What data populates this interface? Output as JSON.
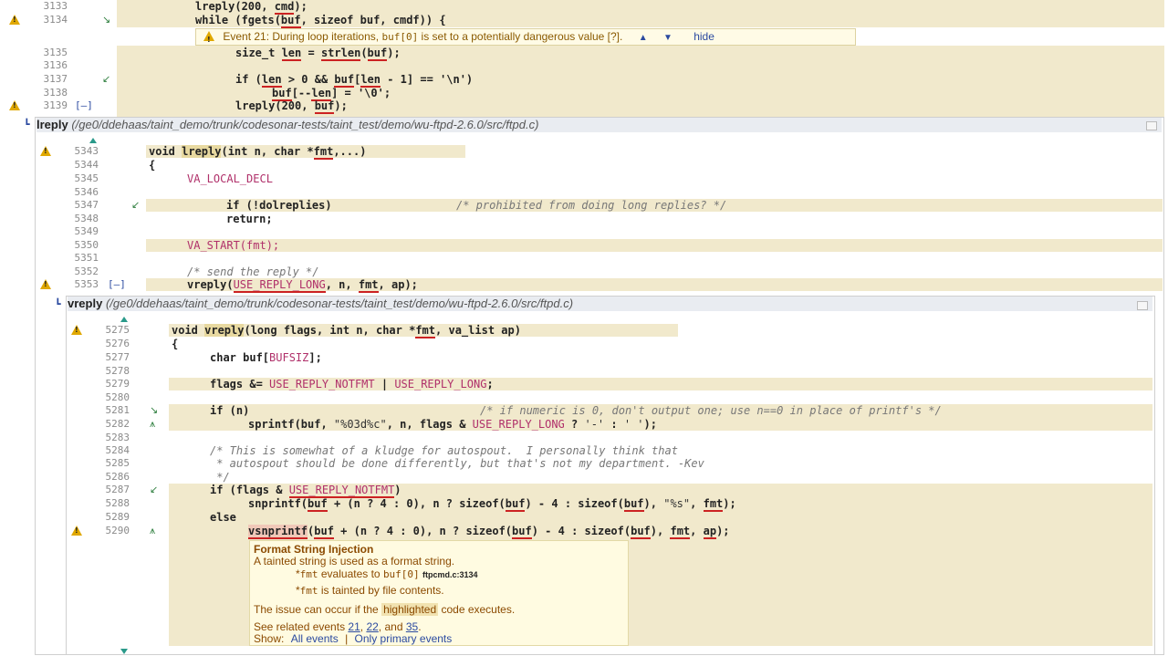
{
  "top_block": {
    "lines": [
      {
        "num": "3133",
        "code": "lreply(200, cmd);"
      },
      {
        "num": "3134",
        "code": "while (fgets(buf, sizeof buf, cmdf)) {"
      },
      {
        "num": "3135",
        "code": "size_t len = strlen(buf);"
      },
      {
        "num": "3136",
        "code": ""
      },
      {
        "num": "3137",
        "code": "if (len > 0 && buf[len - 1] == '\\n')"
      },
      {
        "num": "3138",
        "code": "buf[--len] = '\\0';"
      },
      {
        "num": "3139",
        "code": "lreply(200, buf);"
      }
    ],
    "toggle": "[–]",
    "event": {
      "text_a": "Event 21:  During loop iterations, ",
      "text_code": "buf[0]",
      "text_b": " is set to a potentially dangerous value [?].",
      "up": "▲",
      "down": "▼",
      "hide": "hide"
    }
  },
  "lreply": {
    "name": "lreply",
    "path": "(/ge0/ddehaas/taint_demo/trunk/codesonar-tests/taint_test/demo/wu-ftpd-2.6.0/src/ftpd.c)",
    "lines": [
      {
        "num": "5343",
        "code": "void lreply(int n, char *fmt,...)"
      },
      {
        "num": "5344",
        "code": "{"
      },
      {
        "num": "5345",
        "code": "VA_LOCAL_DECL"
      },
      {
        "num": "5346",
        "code": ""
      },
      {
        "num": "5347",
        "code": "if (!dolreplies)",
        "comment": "/* prohibited from doing long replies? */"
      },
      {
        "num": "5348",
        "code": "return;"
      },
      {
        "num": "5349",
        "code": ""
      },
      {
        "num": "5350",
        "code": "VA_START(fmt);"
      },
      {
        "num": "5351",
        "code": ""
      },
      {
        "num": "5352",
        "code": "/* send the reply */"
      },
      {
        "num": "5353",
        "code": "vreply(USE_REPLY_LONG, n, fmt, ap);"
      }
    ],
    "toggle": "[–]"
  },
  "vreply": {
    "name": "vreply",
    "path": "(/ge0/ddehaas/taint_demo/trunk/codesonar-tests/taint_test/demo/wu-ftpd-2.6.0/src/ftpd.c)",
    "lines": [
      {
        "num": "5275",
        "code": "void vreply(long flags, int n, char *fmt, va_list ap)"
      },
      {
        "num": "5276",
        "code": "{"
      },
      {
        "num": "5277",
        "code": "char buf[BUFSIZ];"
      },
      {
        "num": "5278",
        "code": ""
      },
      {
        "num": "5279",
        "code": "flags &= USE_REPLY_NOTFMT | USE_REPLY_LONG;"
      },
      {
        "num": "5280",
        "code": ""
      },
      {
        "num": "5281",
        "code": "if (n)",
        "comment": "/* if numeric is 0, don't output one; use n==0 in place of printf's */"
      },
      {
        "num": "5282",
        "code": "sprintf(buf, \"%03d%c\", n, flags & USE_REPLY_LONG ? '-' : ' ');"
      },
      {
        "num": "5283",
        "code": ""
      },
      {
        "num": "5284",
        "code": "/* This is somewhat of a kludge for autospout.  I personally think that"
      },
      {
        "num": "5285",
        "code": " * autospout should be done differently, but that's not my department. -Kev"
      },
      {
        "num": "5286",
        "code": " */"
      },
      {
        "num": "5287",
        "code": "if (flags & USE_REPLY_NOTFMT)"
      },
      {
        "num": "5288",
        "code": "snprintf(buf + (n ? 4 : 0), n ? sizeof(buf) - 4 : sizeof(buf), \"%s\", fmt);"
      },
      {
        "num": "5289",
        "code": ""
      },
      {
        "num": "5289b",
        "code": "else"
      },
      {
        "num": "5290",
        "code": "vsnprintf(buf + (n ? 4 : 0), n ? sizeof(buf) - 4 : sizeof(buf), fmt, ap);"
      }
    ],
    "popup": {
      "title": "Format String Injection",
      "desc": "A tainted string is used as a format string.",
      "bullet1_a": "*",
      "bullet1_code": "fmt",
      "bullet1_b": " evaluates to ",
      "bullet1_code2": "buf[0]",
      "bullet1_ref": "ftpcmd.c:3134",
      "bullet2_a": "*",
      "bullet2_code": "fmt",
      "bullet2_b": " is tainted by file contents.",
      "issue_a": "The issue can occur if the ",
      "issue_hl": "highlighted",
      "issue_b": " code executes.",
      "related_a": "See related events ",
      "ev1": "21",
      "sep1": ", ",
      "ev2": "22",
      "sep2": ", and ",
      "ev3": "35",
      "dot": ".",
      "show_label": "Show:",
      "show_all": "All events",
      "show_sep": "|",
      "show_primary": "Only primary events"
    }
  },
  "colors": {
    "highlight": "#f1e9cc",
    "warning": "#e0a800",
    "link": "#2b4aa0"
  }
}
